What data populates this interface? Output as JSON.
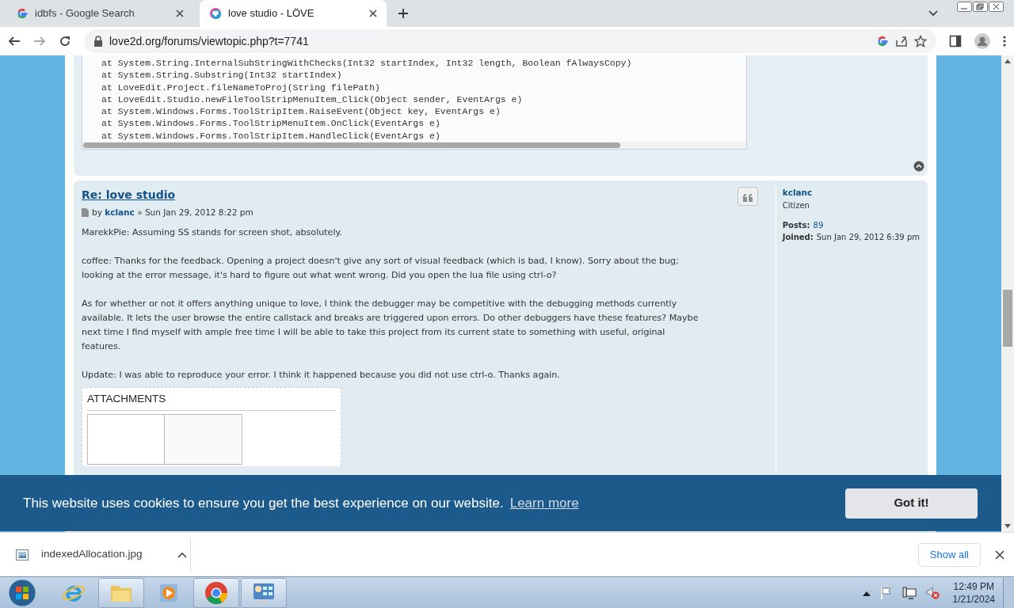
{
  "browser": {
    "tabs": [
      {
        "title": "idbfs - Google Search",
        "selected": false
      },
      {
        "title": "love studio - LÖVE",
        "selected": true
      }
    ],
    "address": "love2d.org/forums/viewtopic.php?t=7741"
  },
  "previous_post": {
    "code_lines": [
      "at System.String.InternalSubStringWithChecks(Int32 startIndex, Int32 length, Boolean fAlwaysCopy)",
      "at System.String.Substring(Int32 startIndex)",
      "at LoveEdit.Project.fileNameToProj(String filePath)",
      "at LoveEdit.Studio.newFileToolStripMenuItem_Click(Object sender, EventArgs e)",
      "at System.Windows.Forms.ToolStripItem.RaiseEvent(Object key, EventArgs e)",
      "at System.Windows.Forms.ToolStripMenuItem.OnClick(EventArgs e)",
      "at System.Windows.Forms.ToolStripItem.HandleClick(EventArgs e)"
    ]
  },
  "post": {
    "title": "Re: love studio",
    "by": "by",
    "author": "kclanc",
    "date": "» Sun Jan 29, 2012 8:22 pm",
    "paragraphs": [
      "MarekkPie: Assuming SS stands for screen shot, absolutely.",
      "coffee: Thanks for the feedback. Opening a project doesn't give any sort of visual feedback (which is bad, I know). Sorry about the bug; looking at the error message, it's hard to figure out what went wrong. Did you open the lua file using ctrl-o?",
      "As for whether or not it offers anything unique to love, I think the debugger may be competitive with the debugging methods currently available. It lets the user browse the entire callstack and breaks are triggered upon errors. Do other debuggers have these features? Maybe next time I find myself with ample free time I will be able to take this project from its current state to something with useful, original features.",
      "Update: I was able to reproduce your error. I think it happened because you did not use ctrl-o. Thanks again."
    ],
    "attachments_heading": "ATTACHMENTS",
    "profile": {
      "username": "kclanc",
      "rank": "Citizen",
      "posts_label": "Posts:",
      "posts": "89",
      "joined_label": "Joined:",
      "joined": "Sun Jan 29, 2012 6:39 pm"
    }
  },
  "cookie_banner": {
    "message": "This website uses cookies to ensure you get the best experience on our website.",
    "link": "Learn more",
    "button": "Got it!"
  },
  "downloads": {
    "file": "indexedAllocation.jpg",
    "show_all": "Show all"
  },
  "taskbar": {
    "apps": [
      {
        "kind": "ie",
        "running": false
      },
      {
        "kind": "folder",
        "running": true
      },
      {
        "kind": "media",
        "running": false
      },
      {
        "kind": "chrome",
        "running": true
      },
      {
        "kind": "panel",
        "running": true
      }
    ],
    "time": "12:49 PM",
    "date": "1/21/2024"
  }
}
